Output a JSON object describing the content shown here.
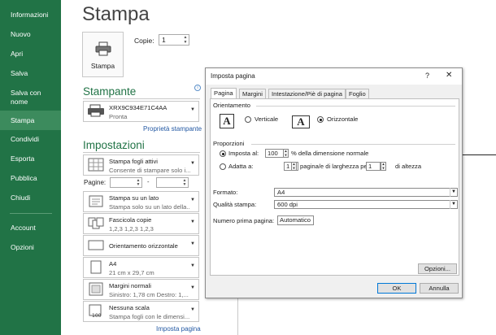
{
  "nav": {
    "items": [
      {
        "label": "Informazioni"
      },
      {
        "label": "Nuovo"
      },
      {
        "label": "Apri"
      },
      {
        "label": "Salva"
      },
      {
        "label": "Salva con nome"
      },
      {
        "label": "Stampa",
        "active": true
      },
      {
        "label": "Condividi"
      },
      {
        "label": "Esporta"
      },
      {
        "label": "Pubblica"
      },
      {
        "label": "Chiudi"
      },
      {
        "label": "Account"
      },
      {
        "label": "Opzioni"
      }
    ]
  },
  "page_title": "Stampa",
  "print_button": {
    "label": "Stampa",
    "icon": "printer-icon"
  },
  "copies": {
    "label": "Copie:",
    "value": "1"
  },
  "printer": {
    "heading": "Stampante",
    "name": "XRX9C934E71C4AA",
    "status": "Pronta",
    "properties_link": "Proprietà stampante",
    "icon": "printer-icon"
  },
  "settings": {
    "heading": "Impostazioni",
    "pages_label": "Pagine:",
    "pages_dash": "-",
    "dropdowns": [
      {
        "line1": "Stampa fogli attivi",
        "line2": "Consente di stampare solo i..."
      },
      {
        "line1": "Stampa su un lato",
        "line2": "Stampa solo su un lato della..."
      },
      {
        "line1": "Fascicola copie",
        "line2": "1,2,3    1,2,3    1,2,3"
      },
      {
        "line1": "Orientamento orizzontale",
        "line2": ""
      },
      {
        "line1": "A4",
        "line2": "21 cm x 29,7 cm"
      },
      {
        "line1": "Margini normali",
        "line2": "Sinistro: 1,78 cm   Destro: 1,..."
      },
      {
        "line1": "Nessuna scala",
        "line2": "Stampa fogli con le dimensi..."
      }
    ],
    "page_setup_link": "Imposta pagina"
  },
  "dialog": {
    "title": "Imposta pagina",
    "help": "?",
    "close": "✕",
    "tabs": [
      "Pagina",
      "Margini",
      "Intestazione/Piè di pagina",
      "Foglio"
    ],
    "orientation": {
      "group_label": "Orientamento",
      "vertical": "Verticale",
      "horizontal": "Orizzontale",
      "selected": "Orizzontale"
    },
    "scaling": {
      "group_label": "Proporzioni",
      "set_to_label": "Imposta al:",
      "set_to_value": "100",
      "set_to_suffix": "% della dimensione normale",
      "fit_to_label": "Adatta a:",
      "fit_wide_value": "1",
      "fit_wide_suffix": "pagina/e di larghezza per",
      "fit_tall_value": "1",
      "fit_tall_suffix": "di altezza"
    },
    "paper_size": {
      "label": "Formato:",
      "value": "A4"
    },
    "print_quality": {
      "label": "Qualità stampa:",
      "value": "600 dpi"
    },
    "first_page": {
      "label": "Numero prima pagina:",
      "value": "Automatico"
    },
    "options_button": "Opzioni...",
    "ok_button": "OK",
    "cancel_button": "Annulla"
  },
  "colors": {
    "nav_bg": "#217346",
    "accent": "#217346",
    "link": "#2459a3"
  }
}
